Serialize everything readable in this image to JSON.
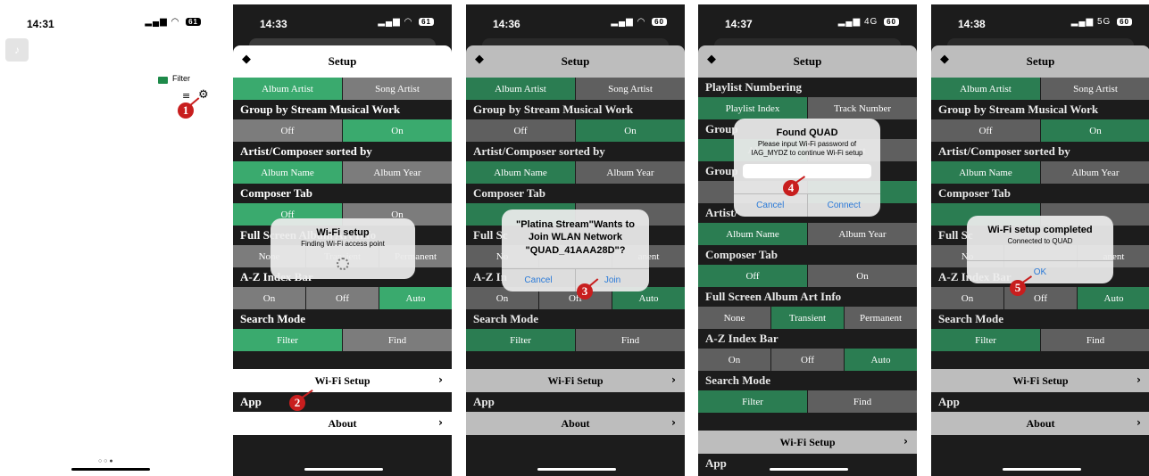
{
  "screens": [
    {
      "time": "14:31",
      "battery": "61",
      "filter_label": "Filter",
      "badge": "1",
      "page_dots": "○ ○ ●"
    },
    {
      "time": "14:33",
      "battery": "61",
      "title": "Setup",
      "rows": {
        "r1": [
          "Album Artist",
          "Song Artist"
        ],
        "h2": "Group by Stream Musical Work",
        "r2": [
          "Off",
          "On"
        ],
        "h3": "Artist/Composer sorted by",
        "r3": [
          "Album Name",
          "Album Year"
        ],
        "h4": "Composer Tab",
        "r4": [
          "Off",
          "On"
        ],
        "h5": "Full Screen Album Art Info",
        "r5": [
          "None",
          "Transient",
          "Permanent"
        ],
        "h6": "A-Z Index Bar",
        "r6": [
          "On",
          "Off",
          "Auto"
        ],
        "h7": "Search Mode",
        "r7": [
          "Filter",
          "Find"
        ]
      },
      "wifi_row": "Wi-Fi Setup",
      "section_app": "App",
      "about_row": "About",
      "dialog": {
        "title": "Wi-Fi setup",
        "sub": "Finding Wi-Fi access point"
      },
      "badge": "2"
    },
    {
      "time": "14:36",
      "battery": "60",
      "title": "Setup",
      "dialog": {
        "title": "\"Platina Stream\"Wants to Join WLAN Network \"QUAD_41AAA28D\"?",
        "cancel": "Cancel",
        "ok": "Join"
      },
      "badge": "3"
    },
    {
      "time": "14:37",
      "network": "4G",
      "battery": "60",
      "title": "Setup",
      "rows": {
        "h0": "Playlist Numbering",
        "r0": [
          "Playlist Index",
          "Track Number"
        ],
        "h1": "Group",
        "h1b": "Group",
        "h2": "Artist/",
        "r2": [
          "Album Name",
          "Album Year"
        ]
      },
      "dialog": {
        "title": "Found QUAD",
        "sub": "Please input Wi-Fi password of IAG_MYDZ to continue Wi-Fi setup",
        "cancel": "Cancel",
        "ok": "Connect"
      },
      "badge": "4"
    },
    {
      "time": "14:38",
      "network": "5G",
      "battery": "60",
      "title": "Setup",
      "dialog": {
        "title": "Wi-Fi setup completed",
        "sub": "Connected to QUAD",
        "ok": "OK"
      },
      "badge": "5"
    }
  ],
  "colors": {
    "selected": "#3aaa6e",
    "unselected": "#7c7c7c",
    "badge": "#c81e1e",
    "link": "#2a7ad8"
  }
}
